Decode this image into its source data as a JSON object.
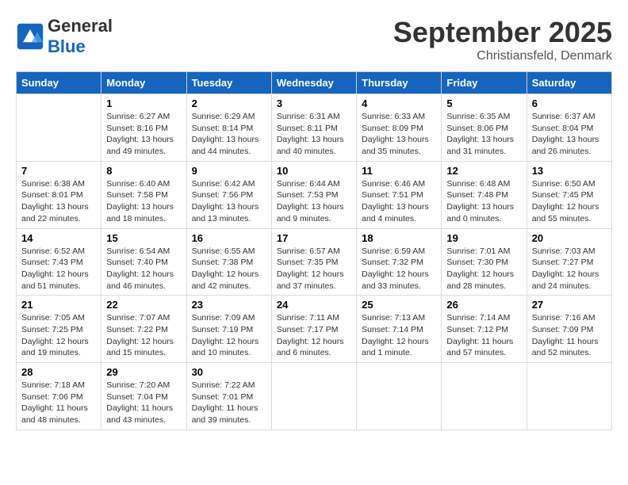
{
  "header": {
    "logo_general": "General",
    "logo_blue": "Blue",
    "month": "September 2025",
    "location": "Christiansfeld, Denmark"
  },
  "days_of_week": [
    "Sunday",
    "Monday",
    "Tuesday",
    "Wednesday",
    "Thursday",
    "Friday",
    "Saturday"
  ],
  "weeks": [
    [
      {
        "day": "",
        "info": ""
      },
      {
        "day": "1",
        "info": "Sunrise: 6:27 AM\nSunset: 8:16 PM\nDaylight: 13 hours\nand 49 minutes."
      },
      {
        "day": "2",
        "info": "Sunrise: 6:29 AM\nSunset: 8:14 PM\nDaylight: 13 hours\nand 44 minutes."
      },
      {
        "day": "3",
        "info": "Sunrise: 6:31 AM\nSunset: 8:11 PM\nDaylight: 13 hours\nand 40 minutes."
      },
      {
        "day": "4",
        "info": "Sunrise: 6:33 AM\nSunset: 8:09 PM\nDaylight: 13 hours\nand 35 minutes."
      },
      {
        "day": "5",
        "info": "Sunrise: 6:35 AM\nSunset: 8:06 PM\nDaylight: 13 hours\nand 31 minutes."
      },
      {
        "day": "6",
        "info": "Sunrise: 6:37 AM\nSunset: 8:04 PM\nDaylight: 13 hours\nand 26 minutes."
      }
    ],
    [
      {
        "day": "7",
        "info": "Sunrise: 6:38 AM\nSunset: 8:01 PM\nDaylight: 13 hours\nand 22 minutes."
      },
      {
        "day": "8",
        "info": "Sunrise: 6:40 AM\nSunset: 7:58 PM\nDaylight: 13 hours\nand 18 minutes."
      },
      {
        "day": "9",
        "info": "Sunrise: 6:42 AM\nSunset: 7:56 PM\nDaylight: 13 hours\nand 13 minutes."
      },
      {
        "day": "10",
        "info": "Sunrise: 6:44 AM\nSunset: 7:53 PM\nDaylight: 13 hours\nand 9 minutes."
      },
      {
        "day": "11",
        "info": "Sunrise: 6:46 AM\nSunset: 7:51 PM\nDaylight: 13 hours\nand 4 minutes."
      },
      {
        "day": "12",
        "info": "Sunrise: 6:48 AM\nSunset: 7:48 PM\nDaylight: 13 hours\nand 0 minutes."
      },
      {
        "day": "13",
        "info": "Sunrise: 6:50 AM\nSunset: 7:45 PM\nDaylight: 12 hours\nand 55 minutes."
      }
    ],
    [
      {
        "day": "14",
        "info": "Sunrise: 6:52 AM\nSunset: 7:43 PM\nDaylight: 12 hours\nand 51 minutes."
      },
      {
        "day": "15",
        "info": "Sunrise: 6:54 AM\nSunset: 7:40 PM\nDaylight: 12 hours\nand 46 minutes."
      },
      {
        "day": "16",
        "info": "Sunrise: 6:55 AM\nSunset: 7:38 PM\nDaylight: 12 hours\nand 42 minutes."
      },
      {
        "day": "17",
        "info": "Sunrise: 6:57 AM\nSunset: 7:35 PM\nDaylight: 12 hours\nand 37 minutes."
      },
      {
        "day": "18",
        "info": "Sunrise: 6:59 AM\nSunset: 7:32 PM\nDaylight: 12 hours\nand 33 minutes."
      },
      {
        "day": "19",
        "info": "Sunrise: 7:01 AM\nSunset: 7:30 PM\nDaylight: 12 hours\nand 28 minutes."
      },
      {
        "day": "20",
        "info": "Sunrise: 7:03 AM\nSunset: 7:27 PM\nDaylight: 12 hours\nand 24 minutes."
      }
    ],
    [
      {
        "day": "21",
        "info": "Sunrise: 7:05 AM\nSunset: 7:25 PM\nDaylight: 12 hours\nand 19 minutes."
      },
      {
        "day": "22",
        "info": "Sunrise: 7:07 AM\nSunset: 7:22 PM\nDaylight: 12 hours\nand 15 minutes."
      },
      {
        "day": "23",
        "info": "Sunrise: 7:09 AM\nSunset: 7:19 PM\nDaylight: 12 hours\nand 10 minutes."
      },
      {
        "day": "24",
        "info": "Sunrise: 7:11 AM\nSunset: 7:17 PM\nDaylight: 12 hours\nand 6 minutes."
      },
      {
        "day": "25",
        "info": "Sunrise: 7:13 AM\nSunset: 7:14 PM\nDaylight: 12 hours\nand 1 minute."
      },
      {
        "day": "26",
        "info": "Sunrise: 7:14 AM\nSunset: 7:12 PM\nDaylight: 11 hours\nand 57 minutes."
      },
      {
        "day": "27",
        "info": "Sunrise: 7:16 AM\nSunset: 7:09 PM\nDaylight: 11 hours\nand 52 minutes."
      }
    ],
    [
      {
        "day": "28",
        "info": "Sunrise: 7:18 AM\nSunset: 7:06 PM\nDaylight: 11 hours\nand 48 minutes."
      },
      {
        "day": "29",
        "info": "Sunrise: 7:20 AM\nSunset: 7:04 PM\nDaylight: 11 hours\nand 43 minutes."
      },
      {
        "day": "30",
        "info": "Sunrise: 7:22 AM\nSunset: 7:01 PM\nDaylight: 11 hours\nand 39 minutes."
      },
      {
        "day": "",
        "info": ""
      },
      {
        "day": "",
        "info": ""
      },
      {
        "day": "",
        "info": ""
      },
      {
        "day": "",
        "info": ""
      }
    ]
  ]
}
